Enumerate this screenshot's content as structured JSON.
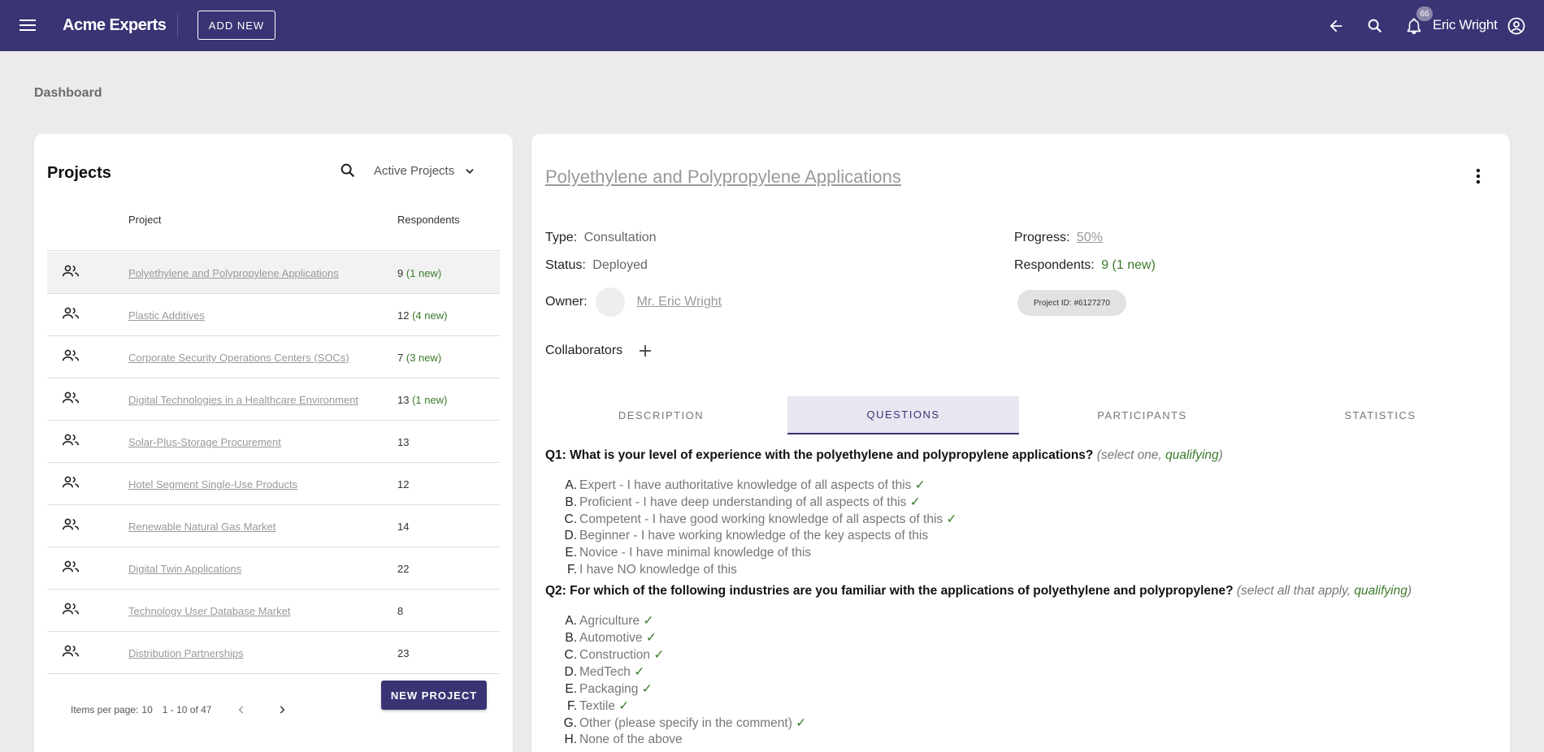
{
  "topbar": {
    "brand": "Acme Experts",
    "add_new_label": "ADD NEW",
    "notification_count": "66",
    "user_name": "Eric Wright"
  },
  "breadcrumb": "Dashboard",
  "projects_panel": {
    "title": "Projects",
    "filter_label": "Active Projects",
    "columns": [
      "Project",
      "Respondents"
    ],
    "rows": [
      {
        "name": "Polyethylene and Polypropylene Applications",
        "count": "9",
        "new": "(1 new)"
      },
      {
        "name": "Plastic Additives",
        "count": "12",
        "new": "(4 new)"
      },
      {
        "name": "Corporate Security Operations Centers (SOCs)",
        "count": "7",
        "new": "(3 new)"
      },
      {
        "name": "Digital Technologies in a Healthcare Environment",
        "count": "13",
        "new": "(1 new)"
      },
      {
        "name": "Solar-Plus-Storage Procurement",
        "count": "13",
        "new": ""
      },
      {
        "name": "Hotel Segment Single-Use Products",
        "count": "12",
        "new": ""
      },
      {
        "name": "Renewable Natural Gas Market",
        "count": "14",
        "new": ""
      },
      {
        "name": "Digital Twin Applications",
        "count": "22",
        "new": ""
      },
      {
        "name": "Technology User Database Market",
        "count": "8",
        "new": ""
      },
      {
        "name": "Distribution Partnerships",
        "count": "23",
        "new": ""
      }
    ],
    "items_per_page_label": "Items per page:",
    "items_per_page": "10",
    "range": "1 - 10 of 47",
    "new_project_label": "NEW PROJECT"
  },
  "detail": {
    "title": "Polyethylene and Polypropylene Applications",
    "type_label": "Type:",
    "type_value": "Consultation",
    "status_label": "Status:",
    "status_value": "Deployed",
    "owner_label": "Owner:",
    "owner_value": "Mr. Eric Wright",
    "progress_label": "Progress:",
    "progress_value": "50%",
    "respondents_label": "Respondents:",
    "respondents_count": "9",
    "respondents_new": "(1 new)",
    "project_id": "Project ID: #6127270",
    "collaborators_label": "Collaborators",
    "tabs": [
      "DESCRIPTION",
      "QUESTIONS",
      "PARTICIPANTS",
      "STATISTICS"
    ],
    "active_tab": "QUESTIONS",
    "questions": [
      {
        "title": "Q1: What is your level of experience with the polyethylene and polypropylene applications?",
        "hint_a": "(select one, ",
        "hint_q": "qualifying",
        "hint_b": ")",
        "options": [
          {
            "letter": "A.",
            "text": "Expert - I have authoritative knowledge of all aspects of this",
            "check": "✓"
          },
          {
            "letter": "B.",
            "text": "Proficient - I have deep understanding of all aspects of this",
            "check": "✓"
          },
          {
            "letter": "C.",
            "text": "Competent - I have good working knowledge of all aspects of this",
            "check": "✓"
          },
          {
            "letter": "D.",
            "text": "Beginner - I have working knowledge of the key aspects of this",
            "check": ""
          },
          {
            "letter": "E.",
            "text": "Novice - I have minimal knowledge of this",
            "check": ""
          },
          {
            "letter": "F.",
            "text": "I have NO knowledge of this",
            "check": ""
          }
        ]
      },
      {
        "title": "Q2: For which of the following industries are you familiar with the applications of polyethylene and polypropylene?",
        "hint_a": "(select all that apply, ",
        "hint_q": "qualifying",
        "hint_b": ")",
        "options": [
          {
            "letter": "A.",
            "text": "Agriculture",
            "check": "✓"
          },
          {
            "letter": "B.",
            "text": "Automotive",
            "check": "✓"
          },
          {
            "letter": "C.",
            "text": "Construction",
            "check": "✓"
          },
          {
            "letter": "D.",
            "text": "MedTech",
            "check": "✓"
          },
          {
            "letter": "E.",
            "text": "Packaging",
            "check": "✓"
          },
          {
            "letter": "F.",
            "text": "Textile",
            "check": "✓"
          },
          {
            "letter": "G.",
            "text": "Other (please specify in the comment)",
            "check": "✓"
          },
          {
            "letter": "H.",
            "text": "None of the above",
            "check": ""
          }
        ]
      }
    ]
  },
  "colors": {
    "brand": "#3a3474",
    "new": "#3b7a2b",
    "background": "#ecebea"
  }
}
